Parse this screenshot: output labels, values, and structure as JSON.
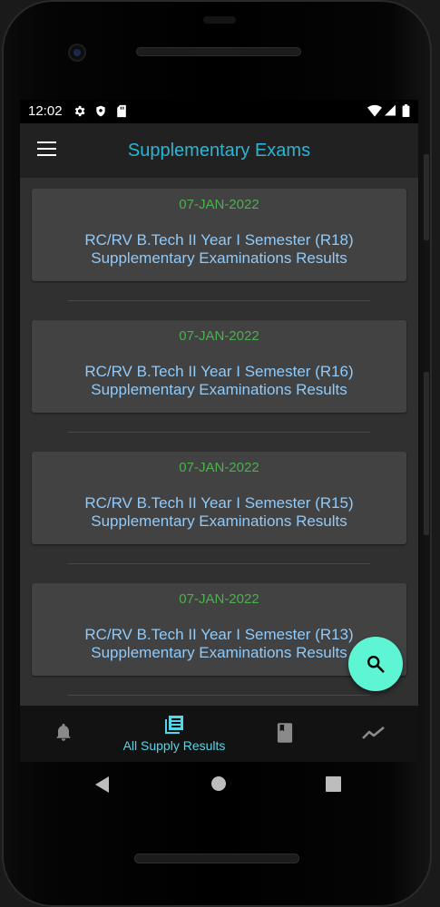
{
  "status_bar": {
    "time": "12:02",
    "left_icons": [
      "gear-icon",
      "shield-icon",
      "sd-card-icon"
    ],
    "right_icons": [
      "wifi-icon",
      "signal-icon",
      "battery-icon"
    ]
  },
  "app_bar": {
    "title": "Supplementary Exams",
    "menu_icon": "menu-icon"
  },
  "results": [
    {
      "date": "07-JAN-2022",
      "title_line1": "RC/RV B.Tech II Year I Semester (R18)",
      "title_line2": "Supplementary Examinations Results"
    },
    {
      "date": "07-JAN-2022",
      "title_line1": "RC/RV B.Tech II Year I Semester (R16)",
      "title_line2": "Supplementary Examinations Results"
    },
    {
      "date": "07-JAN-2022",
      "title_line1": "RC/RV B.Tech II Year I Semester (R15)",
      "title_line2": "Supplementary Examinations Results"
    },
    {
      "date": "07-JAN-2022",
      "title_line1": "RC/RV B.Tech II Year I Semester (R13)",
      "title_line2": "Supplementary Examinations Results"
    }
  ],
  "fab": {
    "icon": "search-icon"
  },
  "bottom_nav": {
    "items": [
      {
        "icon": "bell-icon",
        "label": ""
      },
      {
        "icon": "library-books-icon",
        "label": "All Supply Results",
        "active": true
      },
      {
        "icon": "book-icon",
        "label": ""
      },
      {
        "icon": "trending-icon",
        "label": ""
      }
    ]
  },
  "colors": {
    "accent_title": "#29b6d6",
    "date_green": "#4caf50",
    "link_blue": "#90caf9",
    "fab": "#5ef5d4",
    "active_nav": "#53d6ea"
  }
}
